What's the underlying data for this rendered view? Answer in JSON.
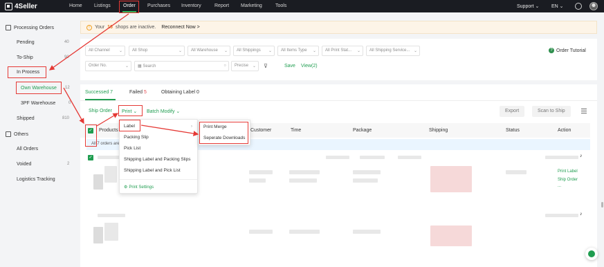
{
  "app": {
    "name": "4Seller"
  },
  "nav": {
    "items": [
      "Home",
      "Listings",
      "Order",
      "Purchases",
      "Inventory",
      "Report",
      "Marketing",
      "Tools"
    ],
    "active": "Order",
    "support": "Support",
    "language": "EN"
  },
  "sidebar": {
    "group1": "Processing Orders",
    "items": [
      {
        "label": "Pending",
        "count": "40"
      },
      {
        "label": "To-Ship",
        "count": "90"
      },
      {
        "label": "In Process",
        "count": ""
      },
      {
        "label": "Own Warehouse",
        "count": "12"
      },
      {
        "label": "3PF Warehouse",
        "count": "0"
      },
      {
        "label": "Shipped",
        "count": "810"
      }
    ],
    "group2": "Others",
    "others": [
      {
        "label": "All Orders",
        "count": ""
      },
      {
        "label": "Voided",
        "count": "2"
      },
      {
        "label": "Logistics Tracking",
        "count": ""
      }
    ]
  },
  "alert": {
    "prefix": "Your",
    "count": "16",
    "suffix": "shops are inactive.",
    "link": "Reconnect Now >"
  },
  "filters": {
    "row1": [
      "All Channel",
      "All Shop",
      "All Warehouse",
      "All Shippings",
      "All Items Type",
      "All Print Stat...",
      "All Shipping Service..."
    ],
    "order_no": "Order No.",
    "search_placeholder": "Search",
    "precise": "Precise",
    "save": "Save",
    "view": "View(2)",
    "tutorial": "Order Tutorial"
  },
  "tabs": {
    "successed": "Successed 7",
    "failed_label": "Failed",
    "failed_count": "5",
    "obtaining": "Obtaining Label 0"
  },
  "toolbar": {
    "ship_order": "Ship Order",
    "print": "Print",
    "batch_modify": "Batch Modify",
    "export": "Export",
    "scan_to_ship": "Scan to Ship"
  },
  "table": {
    "headers": [
      "Products",
      "Customer",
      "Time",
      "Package",
      "Shipping",
      "Status",
      "Action"
    ],
    "selection_text": "All 7 orders are",
    "actions": [
      "Print Label",
      "Ship Order",
      "..."
    ]
  },
  "print_menu": {
    "items": [
      "Label",
      "Packing Slip",
      "Pick List",
      "Shipping Label and Packing Slips",
      "Shipping Label and Pick List"
    ],
    "settings": "Print Settings"
  },
  "label_submenu": {
    "items": [
      "Print Merge",
      "Seperate Downloads"
    ]
  },
  "colors": {
    "accent": "#1f9d50",
    "highlight": "#e53935",
    "warning": "#e0791f"
  }
}
